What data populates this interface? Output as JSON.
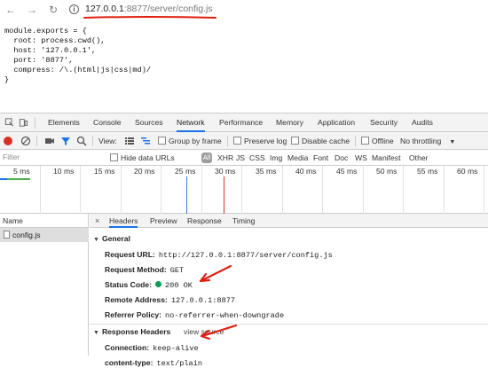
{
  "browser": {
    "url_host": "127.0.0.1",
    "url_rest": ":8877/server/config.js",
    "nav": {
      "back": "←",
      "forward": "→",
      "reload": "↻"
    }
  },
  "page": {
    "code_lines": [
      "module.exports = {",
      "  root: process.cwd(),",
      "  host: '127.0.0.1',",
      "  port: '8877',",
      "  compress: /\\.(html|js|css|md)/",
      "}"
    ]
  },
  "devtools": {
    "tabs": [
      "Elements",
      "Console",
      "Sources",
      "Network",
      "Performance",
      "Memory",
      "Application",
      "Security",
      "Audits"
    ],
    "active_tab": "Network",
    "toolbar": {
      "view_label": "View:",
      "group_by_frame": "Group by frame",
      "preserve_log": "Preserve log",
      "disable_cache": "Disable cache",
      "offline": "Offline",
      "throttling": "No throttling"
    },
    "filter": {
      "placeholder": "Filter",
      "hide_data_urls": "Hide data URLs",
      "all": "All",
      "types": [
        "XHR",
        "JS",
        "CSS",
        "Img",
        "Media",
        "Font",
        "Doc",
        "WS",
        "Manifest",
        "Other"
      ]
    },
    "timeline_ticks": [
      "5 ms",
      "10 ms",
      "15 ms",
      "20 ms",
      "25 ms",
      "30 ms",
      "35 ms",
      "40 ms",
      "45 ms",
      "50 ms",
      "55 ms",
      "60 ms"
    ],
    "requests": {
      "header": "Name",
      "items": [
        "config.js"
      ]
    },
    "detail": {
      "close": "×",
      "tabs": [
        "Headers",
        "Preview",
        "Response",
        "Timing"
      ],
      "active_tab": "Headers",
      "general_title": "General",
      "general": {
        "request_url_label": "Request URL:",
        "request_url": "http://127.0.0.1:8877/server/config.js",
        "request_method_label": "Request Method:",
        "request_method": "GET",
        "status_code_label": "Status Code:",
        "status_code": "200 OK",
        "remote_address_label": "Remote Address:",
        "remote_address": "127.0.0.1:8877",
        "referrer_policy_label": "Referrer Policy:",
        "referrer_policy": "no-referrer-when-downgrade"
      },
      "response_headers_title": "Response Headers",
      "view_source": "view source",
      "response_headers": {
        "connection_label": "Connection:",
        "connection": "keep-alive",
        "content_type_label": "content-type:",
        "content_type": "text/plain"
      }
    }
  },
  "colors": {
    "accent": "#1a73e8",
    "record": "#d93025",
    "annotation": "#e02010",
    "status_ok": "#0f9d58"
  }
}
